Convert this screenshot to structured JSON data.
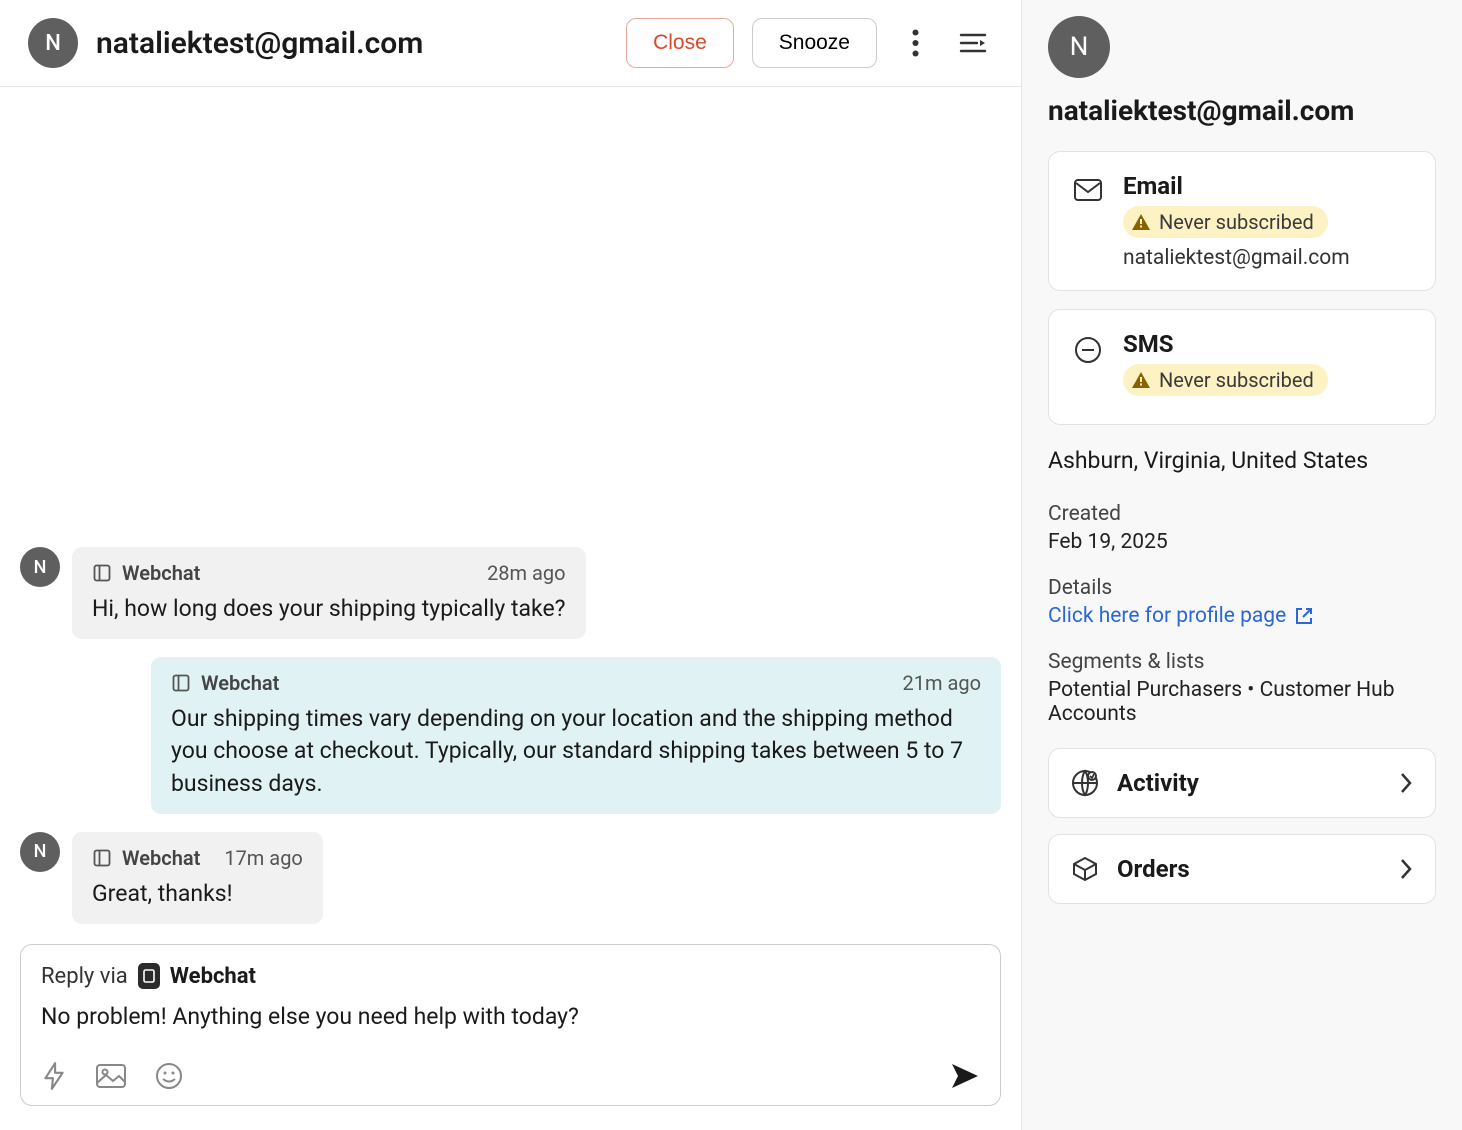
{
  "header": {
    "avatar_initial": "N",
    "title": "nataliektest@gmail.com",
    "close_label": "Close",
    "snooze_label": "Snooze"
  },
  "conversation": {
    "channel_label": "Webchat",
    "messages": [
      {
        "direction": "in",
        "time": "28m ago",
        "text": "Hi, how long does your shipping typically take?"
      },
      {
        "direction": "out",
        "time": "21m ago",
        "text": "Our shipping times vary depending on your location and the shipping method you choose at checkout. Typically, our standard shipping takes between 5 to 7 business days."
      },
      {
        "direction": "in",
        "time": "17m ago",
        "text": "Great, thanks!"
      }
    ]
  },
  "reply": {
    "via_label": "Reply via",
    "channel_label": "Webchat",
    "draft": "No problem! Anything else you need help with today?"
  },
  "sidebar": {
    "avatar_initial": "N",
    "title": "nataliektest@gmail.com",
    "email_card": {
      "title": "Email",
      "status": "Never subscribed",
      "value": "nataliektest@gmail.com"
    },
    "sms_card": {
      "title": "SMS",
      "status": "Never subscribed"
    },
    "location": "Ashburn, Virginia, United States",
    "created_label": "Created",
    "created_value": "Feb 19, 2025",
    "details_label": "Details",
    "details_link": "Click here for profile page",
    "segments_label": "Segments & lists",
    "segments_value": "Potential Purchasers • Customer Hub Accounts",
    "activity_label": "Activity",
    "orders_label": "Orders"
  }
}
